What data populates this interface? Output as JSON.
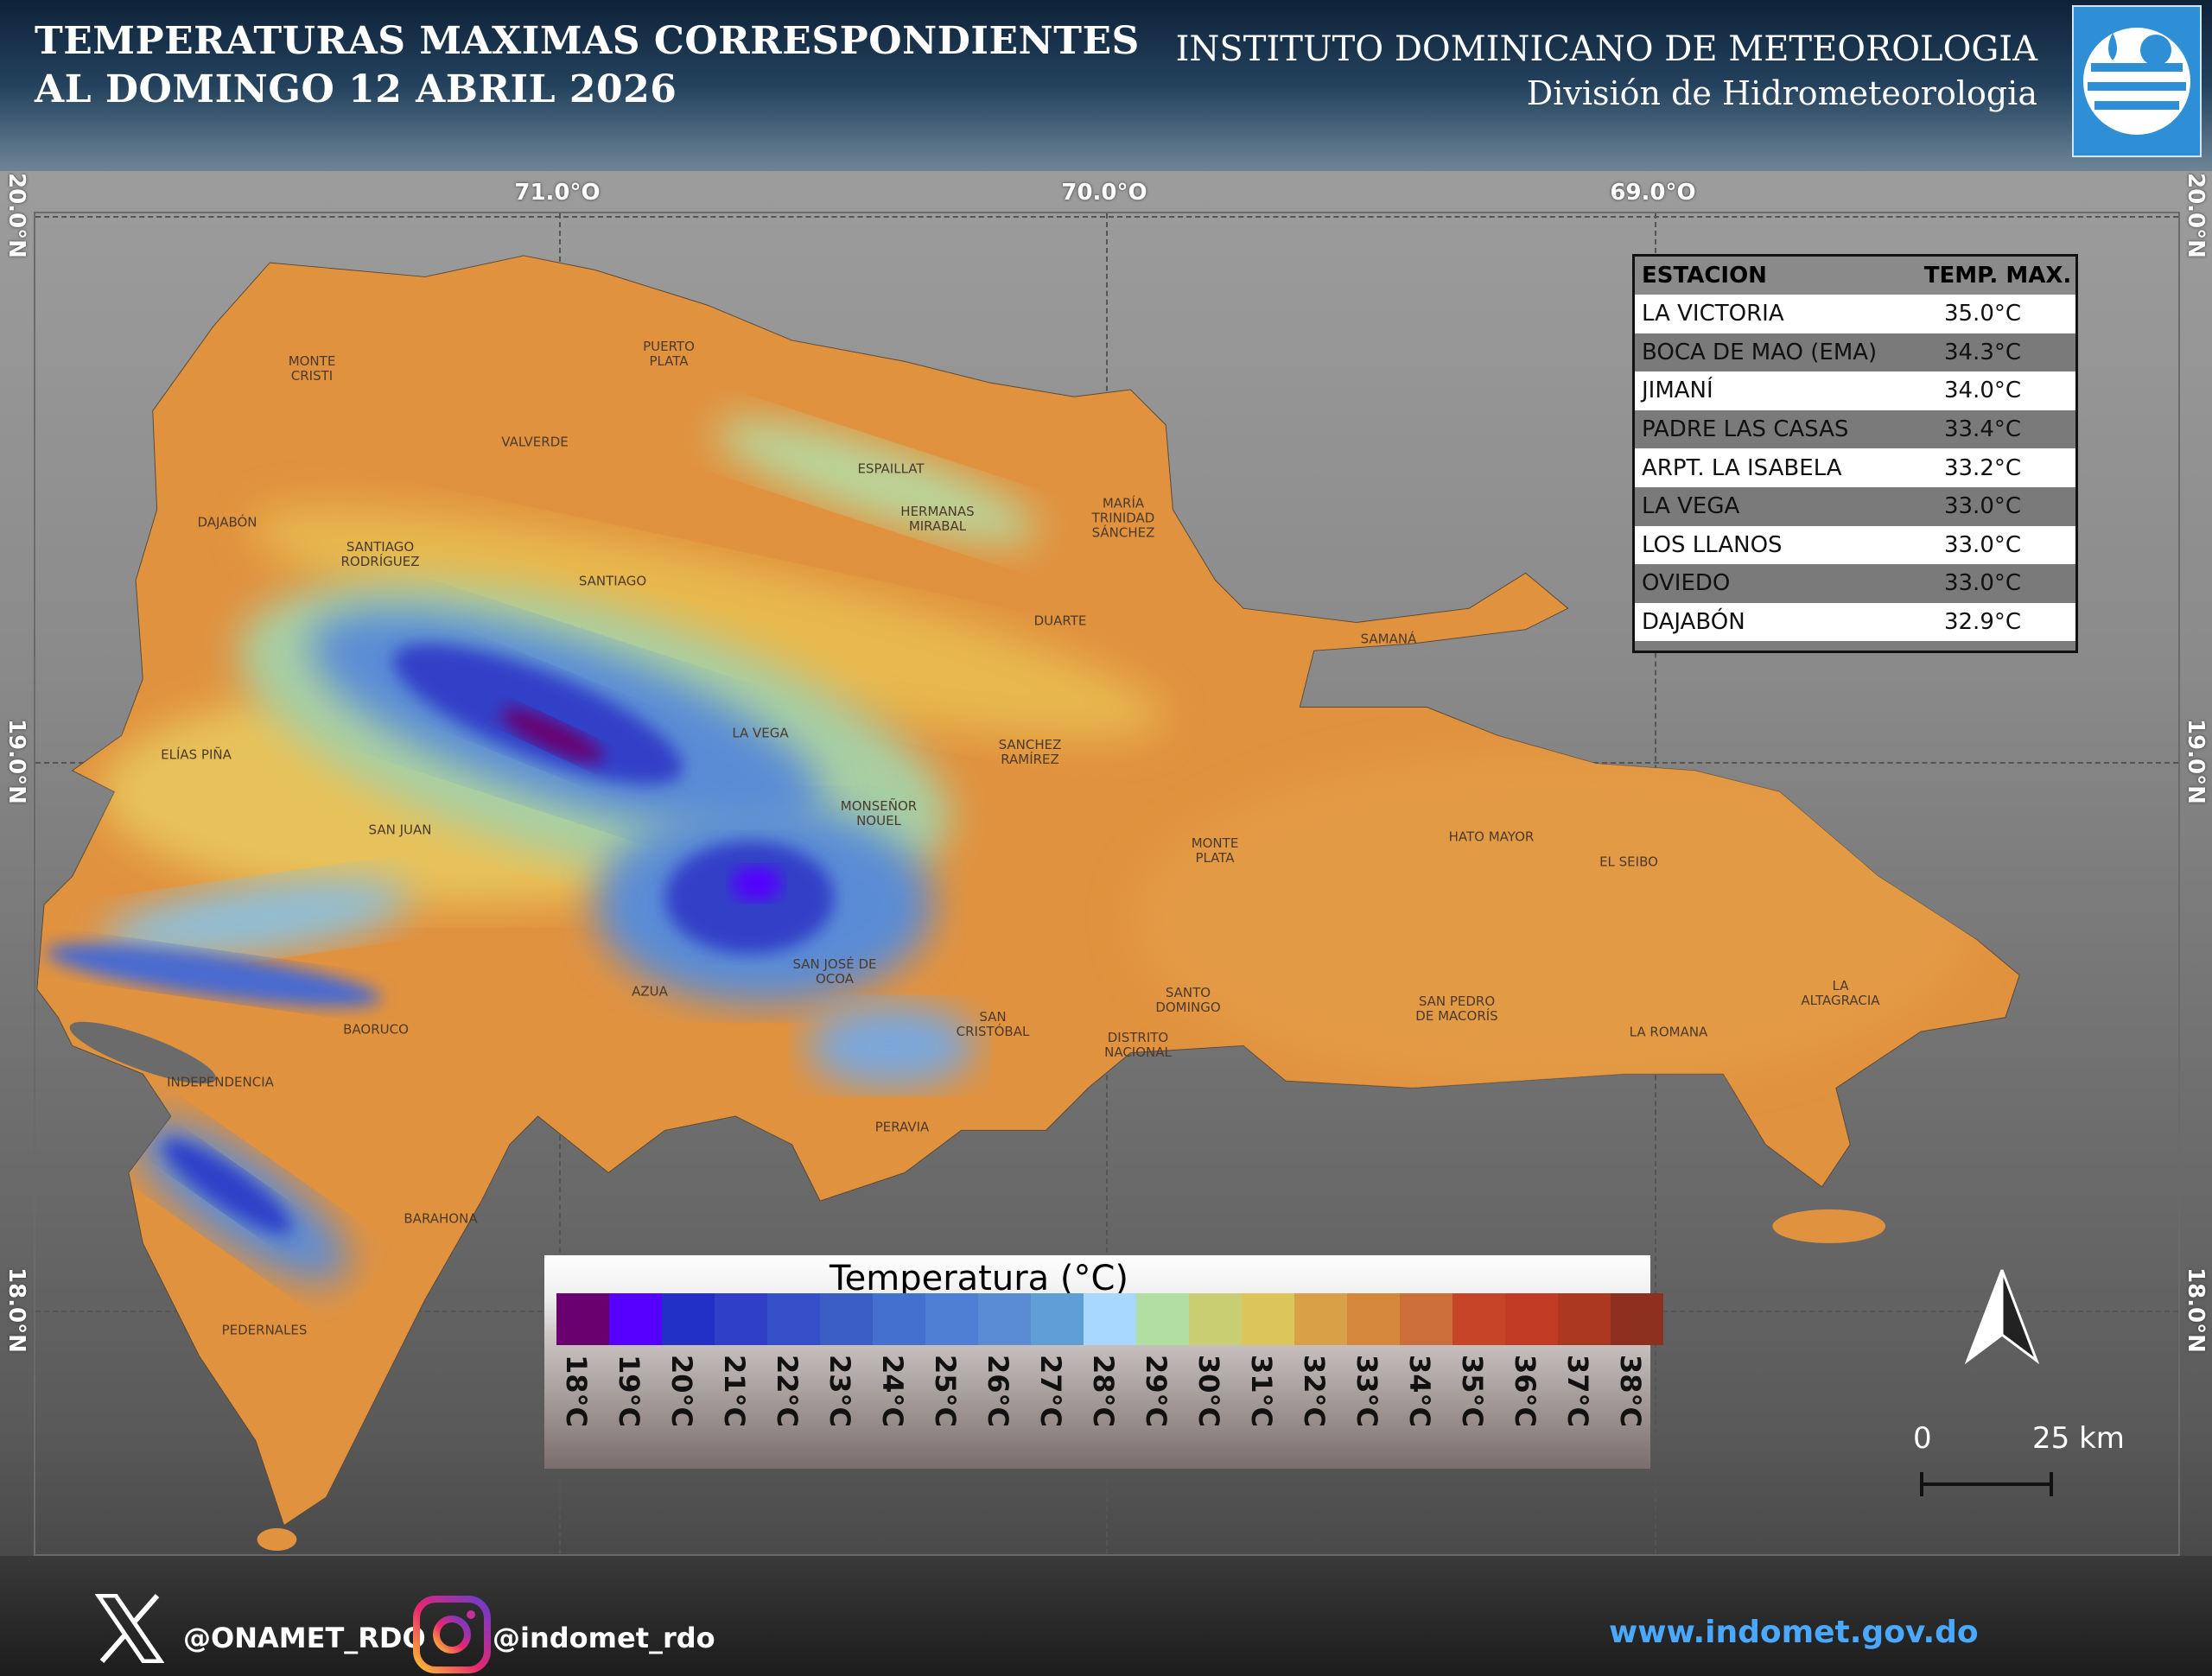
{
  "header": {
    "title_line1": "TEMPERATURAS MAXIMAS CORRESPONDIENTES",
    "title_line2": "AL DOMINGO 12  ABRIL 2026",
    "institute": "INSTITUTO DOMINICANO DE METEOROLOGIA",
    "division": "División de Hidrometeorologia"
  },
  "axes": {
    "lon": [
      "71.0°O",
      "70.0°O",
      "69.0°O"
    ],
    "lat": [
      "20.0°N",
      "19.0°N",
      "18.0°N"
    ]
  },
  "table": {
    "headers": [
      "ESTACION",
      "TEMP. MAX."
    ],
    "rows": [
      [
        "LA VICTORIA",
        "35.0°C"
      ],
      [
        "BOCA DE MAO (EMA)",
        "34.3°C"
      ],
      [
        "JIMANÍ",
        "34.0°C"
      ],
      [
        "PADRE LAS CASAS",
        "33.4°C"
      ],
      [
        "ARPT. LA ISABELA",
        "33.2°C"
      ],
      [
        "LA VEGA",
        "33.0°C"
      ],
      [
        "LOS LLANOS",
        "33.0°C"
      ],
      [
        "OVIEDO",
        "33.0°C"
      ],
      [
        "DAJABÓN",
        "32.9°C"
      ]
    ]
  },
  "legend": {
    "title": "Temperatura (°C)",
    "ticks": [
      "18°C",
      "19°C",
      "20°C",
      "21°C",
      "22°C",
      "23°C",
      "24°C",
      "25°C",
      "26°C",
      "27°C",
      "28°C",
      "29°C",
      "30°C",
      "31°C",
      "32°C",
      "33°C",
      "34°C",
      "35°C",
      "36°C",
      "37°C",
      "38°C"
    ],
    "colors": [
      "#6a0070",
      "#5500ff",
      "#2230c8",
      "#2f3fc8",
      "#3550c8",
      "#3a5ec4",
      "#4470d0",
      "#4f7fd4",
      "#5a8cd6",
      "#609ed8",
      "#a8d8ff",
      "#b2dea2",
      "#c8ce72",
      "#dcc65a",
      "#d9a048",
      "#d5883c",
      "#cc6e38",
      "#c84428",
      "#c03a24",
      "#ac3822",
      "#8e3020"
    ]
  },
  "map": {
    "labels": [
      "MONTE\nCRISTI",
      "PUERTO\nPLATA",
      "VALVERDE",
      "ESPAILLAT",
      "HERMANAS\nMIRABAL",
      "MARÍA\nTRINIDAD\nSÁNCHEZ",
      "DAJABÓN",
      "SANTIAGO\nRODRÍGUEZ",
      "SANTIAGO",
      "DUARTE",
      "SAMANÁ",
      "LA VEGA",
      "SANCHEZ\nRAMÍREZ",
      "ELÍAS PIÑA",
      "MONSEÑOR\nNOUEL",
      "SAN JUAN",
      "MONTE\nPLATA",
      "HATO MAYOR",
      "EL SEIBO",
      "SAN JOSÉ DE\nOCOA",
      "AZUA",
      "LA\nALTAGRACIA",
      "SANTO\nDOMINGO",
      "SAN PEDRO\nDE MACORÍS",
      "SAN\nCRISTÓBAL",
      "BAORUCO",
      "DISTRITO\nNACIONAL",
      "LA ROMANA",
      "INDEPENDENCIA",
      "PERAVIA",
      "BARAHONA",
      "PEDERNALES"
    ]
  },
  "scale": {
    "zero": "0",
    "distance": "25 km"
  },
  "footer": {
    "x_handle": "@ONAMET_RDO",
    "instagram_handle": "@indomet_rdo",
    "website": "www.indomet.gov.do"
  },
  "colors": {
    "land": "#e1923e",
    "website": "#4aa8ff"
  }
}
